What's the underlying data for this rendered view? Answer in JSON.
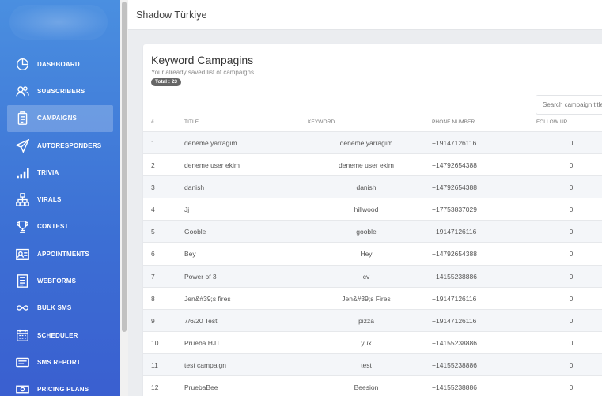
{
  "app": {
    "title": "Shadow Türkiye"
  },
  "sidebar": {
    "items": [
      {
        "label": "DASHBOARD",
        "icon": "dashboard-icon",
        "active": false
      },
      {
        "label": "SUBSCRIBERS",
        "icon": "users-icon",
        "active": false
      },
      {
        "label": "CAMPAIGNS",
        "icon": "clipboard-icon",
        "active": true
      },
      {
        "label": "AUTORESPONDERS",
        "icon": "paper-plane-icon",
        "active": false
      },
      {
        "label": "TRIVIA",
        "icon": "signal-bars-icon",
        "active": false
      },
      {
        "label": "VIRALS",
        "icon": "sitemap-icon",
        "active": false
      },
      {
        "label": "CONTEST",
        "icon": "trophy-icon",
        "active": false
      },
      {
        "label": "APPOINTMENTS",
        "icon": "contact-card-icon",
        "active": false
      },
      {
        "label": "WEBFORMS",
        "icon": "forms-icon",
        "active": false
      },
      {
        "label": "BULK SMS",
        "icon": "infinity-icon",
        "active": false
      },
      {
        "label": "SCHEDULER",
        "icon": "calendar-icon",
        "active": false
      },
      {
        "label": "SMS REPORT",
        "icon": "sms-icon",
        "active": false
      },
      {
        "label": "PRICING PLANS",
        "icon": "money-icon",
        "active": false
      }
    ]
  },
  "card": {
    "title": "Keyword Campagins",
    "subtitle": "Your already saved list of campaigns.",
    "total_badge": "Total : 23",
    "search_placeholder": "Search campaign title"
  },
  "table": {
    "columns": [
      "#",
      "TITLE",
      "KEYWORD",
      "PHONE NUMBER",
      "FOLLOW UP"
    ],
    "rows": [
      [
        "1",
        "deneme yarrağım",
        "deneme yarrağım",
        "+19147126116",
        "0"
      ],
      [
        "2",
        "deneme user ekim",
        "deneme user ekim",
        "+14792654388",
        "0"
      ],
      [
        "3",
        "danish",
        "danish",
        "+14792654388",
        "0"
      ],
      [
        "4",
        "Jj",
        "hillwood",
        "+17753837029",
        "0"
      ],
      [
        "5",
        "Gooble",
        "gooble",
        "+19147126116",
        "0"
      ],
      [
        "6",
        "Bey",
        "Hey",
        "+14792654388",
        "0"
      ],
      [
        "7",
        "Power of 3",
        "cv",
        "+14155238886",
        "0"
      ],
      [
        "8",
        "Jen&#39;s fires",
        "Jen&#39;s Fires",
        "+19147126116",
        "0"
      ],
      [
        "9",
        "7/6/20 Test",
        "pizza",
        "+19147126116",
        "0"
      ],
      [
        "10",
        "Prueba HJT",
        "yux",
        "+14155238886",
        "0"
      ],
      [
        "11",
        "test campaign",
        "test",
        "+14155238886",
        "0"
      ],
      [
        "12",
        "PruebaBee",
        "Beesion",
        "+14155238886",
        "0"
      ]
    ]
  }
}
